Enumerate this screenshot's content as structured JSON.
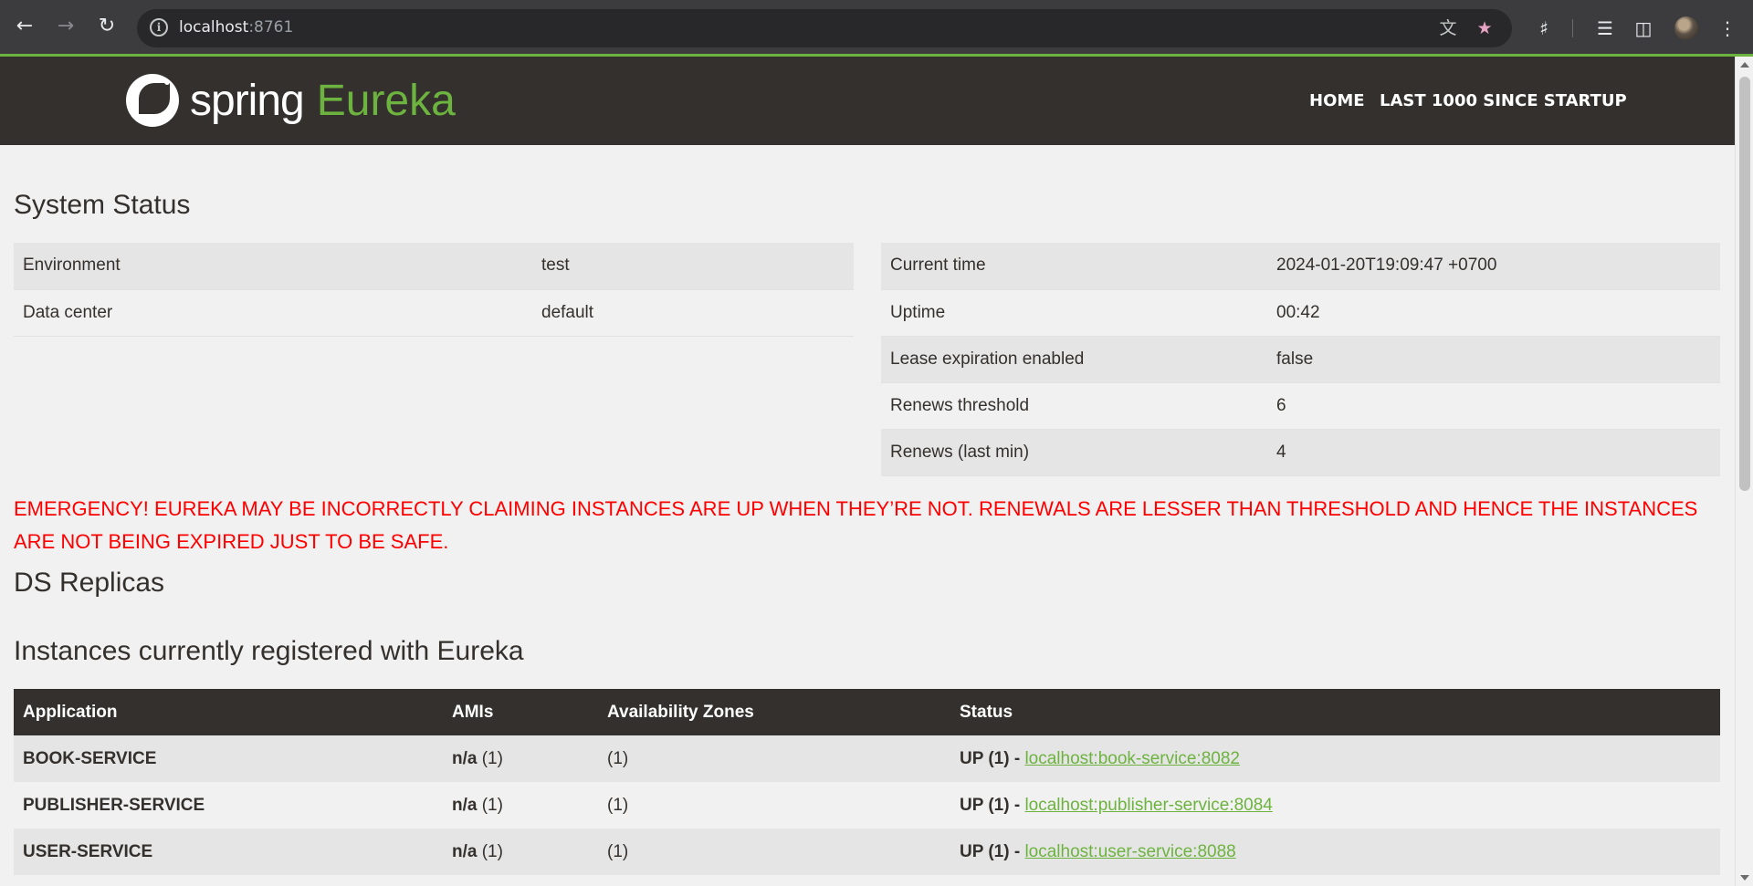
{
  "browser": {
    "back_icon": "arrow-left",
    "forward_icon": "arrow-right",
    "reload_icon": "reload",
    "url_host": "localhost",
    "url_port": ":8761"
  },
  "header": {
    "logo_spring": "spring",
    "logo_eureka": "Eureka",
    "nav_home": "HOME",
    "nav_last1000": "LAST 1000 SINCE STARTUP"
  },
  "system_status": {
    "title": "System Status",
    "left": [
      {
        "label": "Environment",
        "value": "test"
      },
      {
        "label": "Data center",
        "value": "default"
      }
    ],
    "right": [
      {
        "label": "Current time",
        "value": "2024-01-20T19:09:47 +0700"
      },
      {
        "label": "Uptime",
        "value": "00:42"
      },
      {
        "label": "Lease expiration enabled",
        "value": "false"
      },
      {
        "label": "Renews threshold",
        "value": "6"
      },
      {
        "label": "Renews (last min)",
        "value": "4"
      }
    ]
  },
  "emergency_message": "EMERGENCY! EUREKA MAY BE INCORRECTLY CLAIMING INSTANCES ARE UP WHEN THEY’RE NOT. RENEWALS ARE LESSER THAN THRESHOLD AND HENCE THE INSTANCES ARE NOT BEING EXPIRED JUST TO BE SAFE.",
  "ds_replicas_title": "DS Replicas",
  "instances": {
    "title": "Instances currently registered with Eureka",
    "headers": [
      "Application",
      "AMIs",
      "Availability Zones",
      "Status"
    ],
    "rows": [
      {
        "application": "BOOK-SERVICE",
        "ami_label": "n/a",
        "ami_count": " (1)",
        "zones": "(1)",
        "status": "UP (1) - ",
        "link": "localhost:book-service:8082"
      },
      {
        "application": "PUBLISHER-SERVICE",
        "ami_label": "n/a",
        "ami_count": " (1)",
        "zones": "(1)",
        "status": "UP (1) - ",
        "link": "localhost:publisher-service:8084"
      },
      {
        "application": "USER-SERVICE",
        "ami_label": "n/a",
        "ami_count": " (1)",
        "zones": "(1)",
        "status": "UP (1) - ",
        "link": "localhost:user-service:8088"
      }
    ]
  },
  "colors": {
    "accent_green": "#6db33f",
    "header_dark": "#34302d",
    "emergency_red": "#ff0000"
  }
}
